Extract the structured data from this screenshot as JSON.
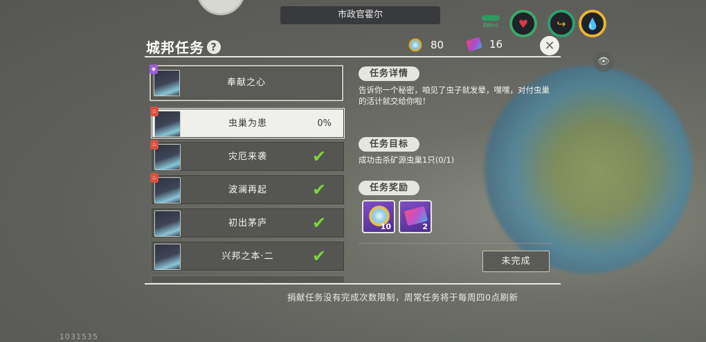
{
  "header": {
    "npc_title": "市政官霍尔"
  },
  "status": {
    "mini_label": "88ms",
    "icons": [
      "heart-icon",
      "arrow-icon",
      "water-drop-icon"
    ]
  },
  "panel": {
    "title": "城邦任务",
    "help_glyph": "?",
    "close_glyph": "✕"
  },
  "currency": {
    "coins": "80",
    "tickets": "16"
  },
  "quests": [
    {
      "name": "奉献之心",
      "badge": "◆",
      "state": "featured",
      "progress": "",
      "done": false
    },
    {
      "name": "虫巢为患",
      "badge": "♨",
      "state": "selected",
      "progress": "0%",
      "done": false
    },
    {
      "name": "灾厄来袭",
      "badge": "♨",
      "state": "normal",
      "progress": "",
      "done": true
    },
    {
      "name": "波澜再起",
      "badge": "♨",
      "state": "normal",
      "progress": "",
      "done": true
    },
    {
      "name": "初出茅庐",
      "badge": "",
      "state": "normal",
      "progress": "",
      "done": true
    },
    {
      "name": "兴邦之本·二",
      "badge": "",
      "state": "normal",
      "progress": "",
      "done": true
    }
  ],
  "details": {
    "detail_label": "任务详情",
    "detail_text": "告诉你一个秘密，咱见了虫子就发晕，嘿嘿，对付虫巢的活计就交给你啦！",
    "goal_label": "任务目标",
    "goal_text": "成功击杀矿源虫巢1只(0/1)",
    "reward_label": "任务奖励",
    "rewards": [
      {
        "icon": "coin-icon",
        "count": "10"
      },
      {
        "icon": "ticket-icon",
        "count": "2"
      }
    ],
    "status_button": "未完成"
  },
  "footer": {
    "note": "捐献任务没有完成次数限制，周常任务将于每周四0点刷新",
    "uid": "1031535"
  }
}
